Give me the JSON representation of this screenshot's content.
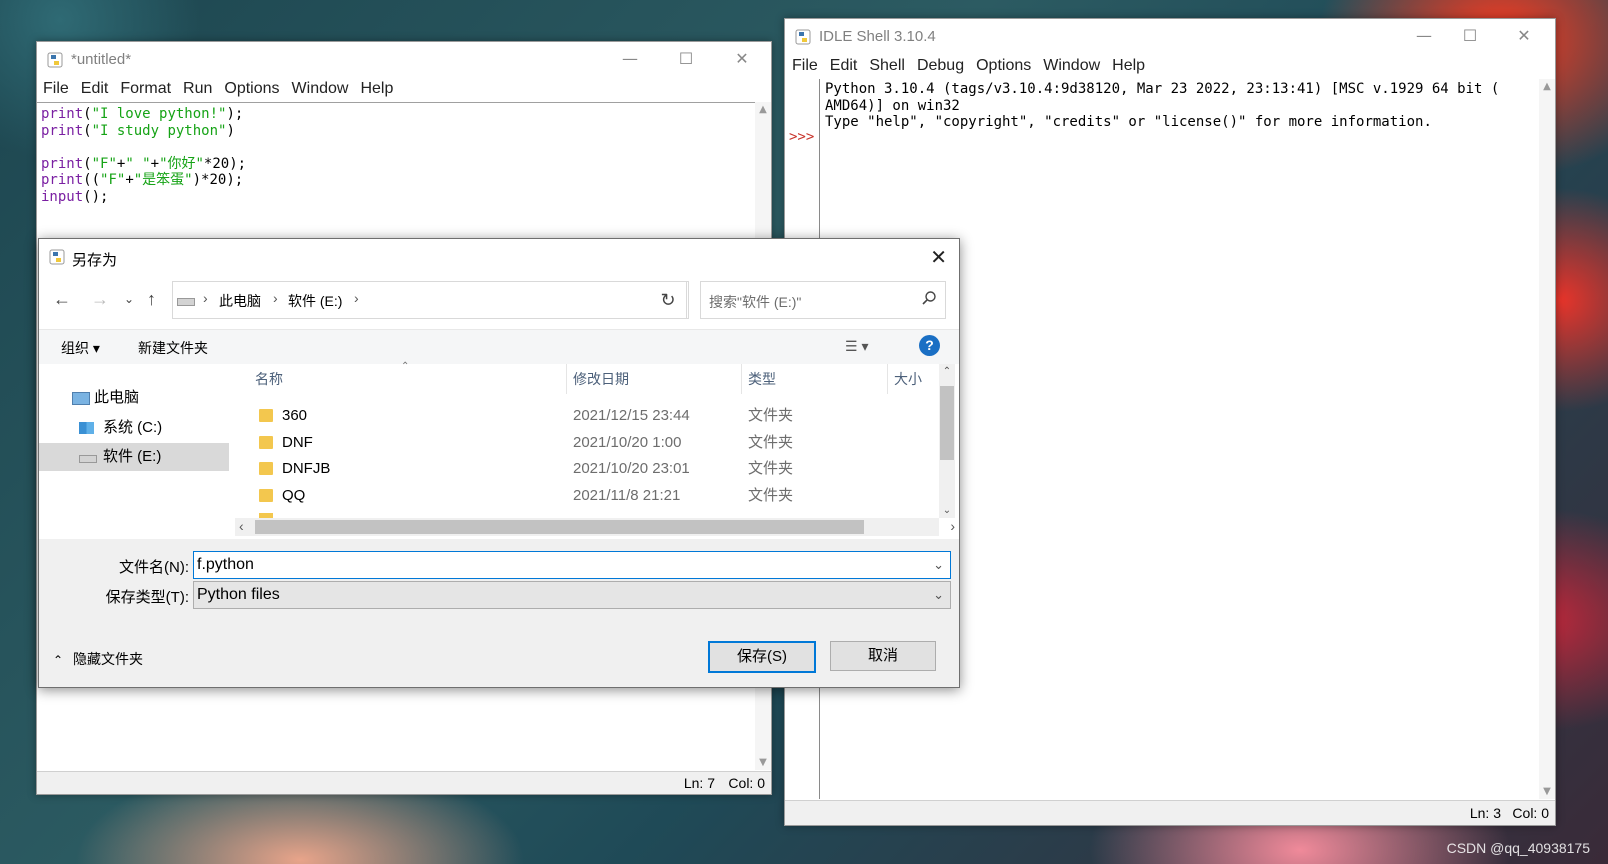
{
  "editor": {
    "title": "*untitled*",
    "menu": [
      "File",
      "Edit",
      "Format",
      "Run",
      "Options",
      "Window",
      "Help"
    ],
    "code": [
      [
        {
          "t": "print",
          "c": "kw"
        },
        {
          "t": "(",
          "c": ""
        },
        {
          "t": "\"I love python!\"",
          "c": "str"
        },
        {
          "t": ");",
          "c": ""
        }
      ],
      [
        {
          "t": "print",
          "c": "kw"
        },
        {
          "t": "(",
          "c": ""
        },
        {
          "t": "\"I study python\"",
          "c": "str"
        },
        {
          "t": ")",
          "c": ""
        }
      ],
      [],
      [
        {
          "t": "print",
          "c": "kw"
        },
        {
          "t": "(",
          "c": ""
        },
        {
          "t": "\"F\"",
          "c": "str"
        },
        {
          "t": "+",
          "c": ""
        },
        {
          "t": "\" \"",
          "c": "str"
        },
        {
          "t": "+",
          "c": ""
        },
        {
          "t": "\"你好\"",
          "c": "str"
        },
        {
          "t": "*20);",
          "c": ""
        }
      ],
      [
        {
          "t": "print",
          "c": "kw"
        },
        {
          "t": "((",
          "c": ""
        },
        {
          "t": "\"F\"",
          "c": "str"
        },
        {
          "t": "+",
          "c": ""
        },
        {
          "t": "\"是笨蛋\"",
          "c": "str"
        },
        {
          "t": ")*20);",
          "c": ""
        }
      ],
      [
        {
          "t": "input",
          "c": "kw"
        },
        {
          "t": "();",
          "c": ""
        }
      ]
    ],
    "status_ln": "Ln: 7",
    "status_col": "Col: 0"
  },
  "shell": {
    "title": "IDLE Shell 3.10.4",
    "menu": [
      "File",
      "Edit",
      "Shell",
      "Debug",
      "Options",
      "Window",
      "Help"
    ],
    "output": [
      "Python 3.10.4 (tags/v3.10.4:9d38120, Mar 23 2022, 23:13:41) [MSC v.1929 64 bit (",
      "AMD64)] on win32",
      "Type \"help\", \"copyright\", \"credits\" or \"license()\" for more information."
    ],
    "prompt": ">>>",
    "status_ln": "Ln: 3",
    "status_col": "Col: 0"
  },
  "dialog": {
    "title": "另存为",
    "breadcrumb": [
      "此电脑",
      "软件 (E:)"
    ],
    "search_placeholder": "搜索\"软件 (E:)\"",
    "organize": "组织 ▾",
    "new_folder": "新建文件夹",
    "tree": [
      "此电脑",
      "系统 (C:)",
      "软件 (E:)"
    ],
    "tree_selected": 2,
    "columns": [
      "名称",
      "修改日期",
      "类型",
      "大小"
    ],
    "rows": [
      {
        "name": "360",
        "date": "2021/12/15 23:44",
        "type": "文件夹"
      },
      {
        "name": "DNF",
        "date": "2021/10/20 1:00",
        "type": "文件夹"
      },
      {
        "name": "DNFJB",
        "date": "2021/10/20 23:01",
        "type": "文件夹"
      },
      {
        "name": "QQ",
        "date": "2021/11/8 21:21",
        "type": "文件夹"
      }
    ],
    "filename_label": "文件名(N):",
    "filename_value": "f.python",
    "filetype_label": "保存类型(T):",
    "filetype_value": "Python files",
    "hide_folders": "隐藏文件夹",
    "save": "保存(S)",
    "cancel": "取消"
  },
  "watermark": "CSDN @qq_40938175"
}
